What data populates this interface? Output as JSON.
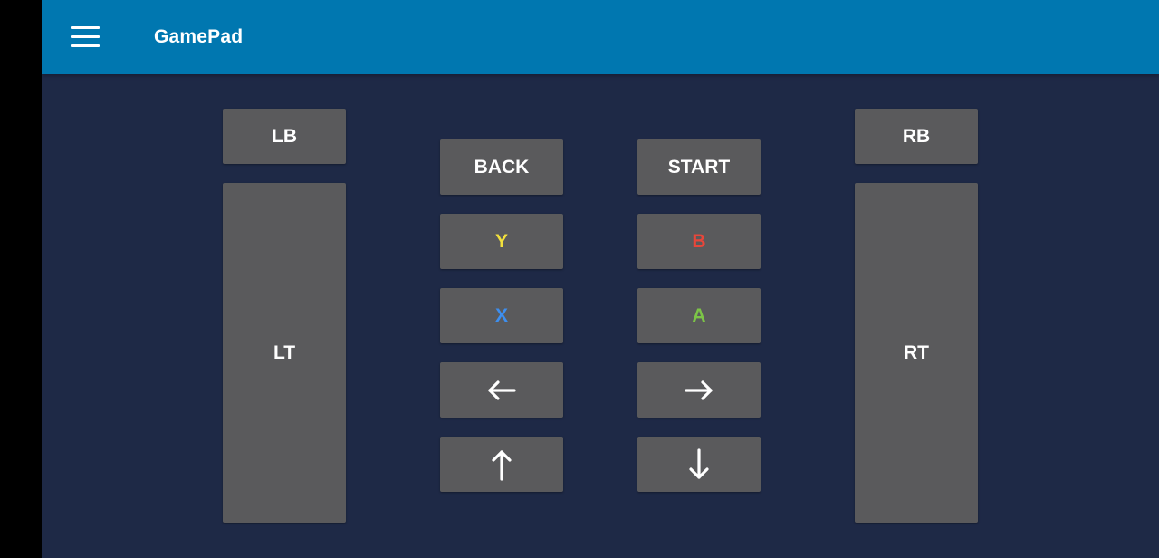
{
  "appbar": {
    "title": "GamePad",
    "menu_icon": "hamburger-menu-icon",
    "color": "#0077b0"
  },
  "background_color": "#1e2946",
  "button_color": "#5a5a5c",
  "shoulder": {
    "lb": "LB",
    "lt": "LT",
    "rb": "RB",
    "rt": "RT"
  },
  "center": {
    "back": "BACK",
    "start": "START"
  },
  "face": {
    "y": {
      "label": "Y",
      "color": "#f2e03c"
    },
    "b": {
      "label": "B",
      "color": "#e8463a"
    },
    "x": {
      "label": "X",
      "color": "#3d8ff0"
    },
    "a": {
      "label": "A",
      "color": "#7cc447"
    }
  },
  "dpad": {
    "left": "arrow-left-icon",
    "right": "arrow-right-icon",
    "up": "arrow-up-icon",
    "down": "arrow-down-icon"
  }
}
